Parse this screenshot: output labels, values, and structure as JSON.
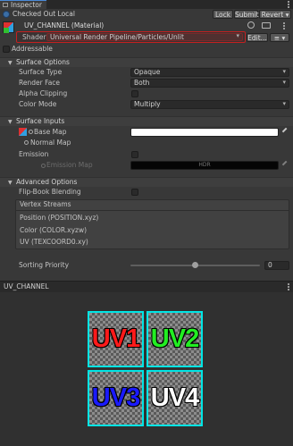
{
  "window": {
    "tab_label": "Inspector"
  },
  "vcs": {
    "status": "Checked Out Local",
    "lock_label": "Lock",
    "submit_label": "Submit",
    "revert_label": "Revert"
  },
  "material": {
    "name": "UV_CHANNEL (Material)",
    "shader_label": "Shader",
    "shader_value": "Universal Render Pipeline/Particles/Unlit",
    "edit_label": "Edit...",
    "list_icon": "list-icon"
  },
  "addressable": {
    "label": "Addressable",
    "checked": false
  },
  "surface_options": {
    "title": "Surface Options",
    "surface_type_label": "Surface Type",
    "surface_type_value": "Opaque",
    "render_face_label": "Render Face",
    "render_face_value": "Both",
    "alpha_clipping_label": "Alpha Clipping",
    "alpha_clipping_checked": false,
    "color_mode_label": "Color Mode",
    "color_mode_value": "Multiply"
  },
  "surface_inputs": {
    "title": "Surface Inputs",
    "base_map_label": "Base Map",
    "base_map_color": "#ffffff",
    "normal_map_label": "Normal Map",
    "emission_label": "Emission",
    "emission_checked": false,
    "emission_map_label": "Emission Map",
    "emission_color_text": "HDR"
  },
  "advanced_options": {
    "title": "Advanced Options",
    "flipbook_label": "Flip-Book Blending",
    "flipbook_checked": false,
    "vertex_streams_title": "Vertex Streams",
    "vertex_streams": [
      "Position (POSITION.xyz)",
      "Color (COLOR.xyzw)",
      "UV (TEXCOORD0.xy)"
    ],
    "sorting_priority_label": "Sorting Priority",
    "sorting_priority_value": "0",
    "sorting_priority_slider": 0.5
  },
  "preview": {
    "title": "UV_CHANNEL",
    "cells": [
      {
        "text": "UV1",
        "color": "#ff1a1a"
      },
      {
        "text": "UV2",
        "color": "#22ee22"
      },
      {
        "text": "UV3",
        "color": "#1a1aff"
      },
      {
        "text": "UV4",
        "color": "#ffffff"
      }
    ]
  }
}
